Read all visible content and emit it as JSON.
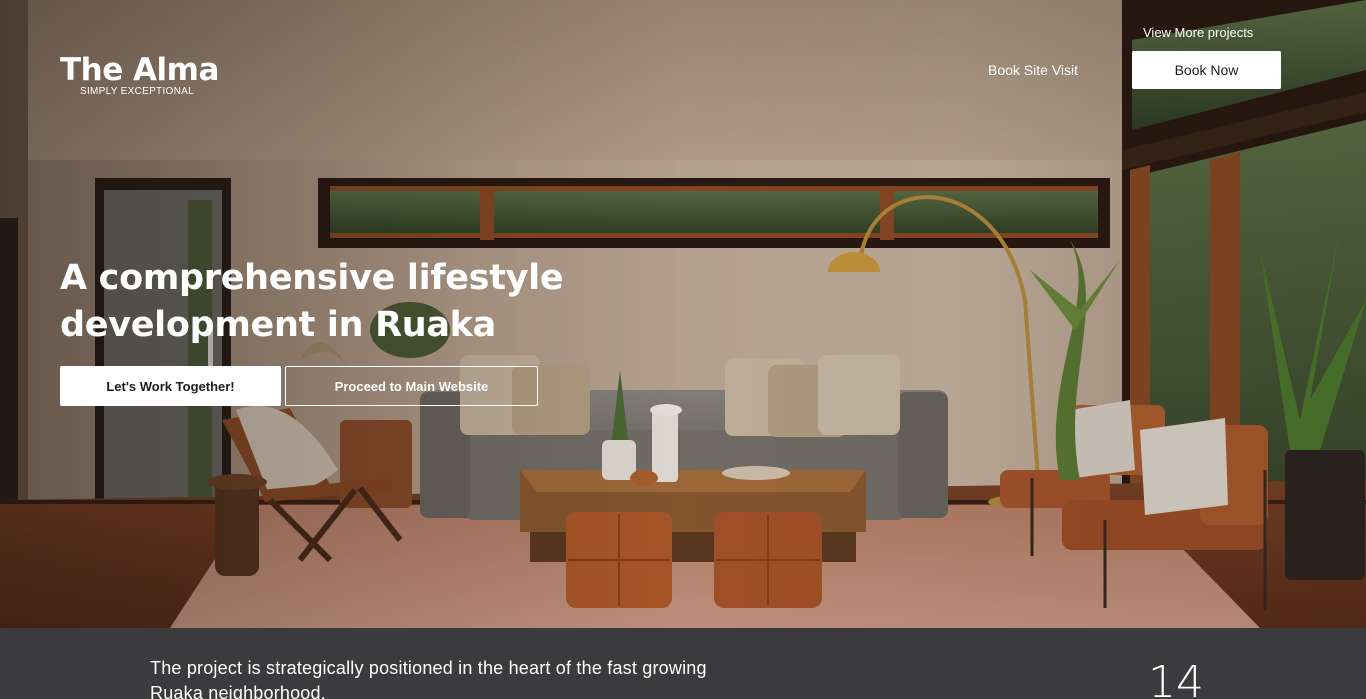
{
  "brand": {
    "name": "The Alma",
    "tagline": "SIMPLY EXCEPTIONAL"
  },
  "nav": {
    "more_projects": "View More projects",
    "book_site_visit": "Book Site Visit",
    "book_now": "Book Now"
  },
  "hero": {
    "headline": "A comprehensive lifestyle development in Ruaka",
    "primary_cta": "Let's Work Together!",
    "secondary_cta": "Proceed to Main Website"
  },
  "intro": {
    "text": "The project is strategically positioned in the heart of the fast growing Ruaka neighborhood.",
    "stat": "14"
  },
  "colors": {
    "overlay_text": "#ffffff",
    "band_background": "#3b3b3d",
    "button_background": "#ffffff"
  }
}
